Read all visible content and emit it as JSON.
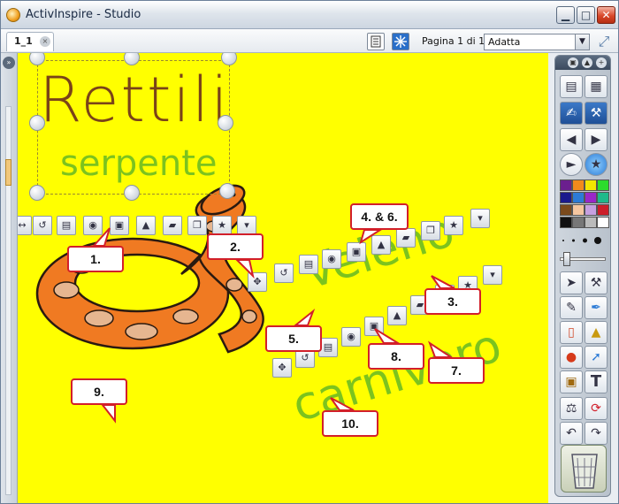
{
  "window": {
    "title": "ActivInspire - Studio"
  },
  "window_controls": {
    "minimize": "▁",
    "maximize": "□",
    "close": "✕"
  },
  "tabs": [
    {
      "label": "1_1",
      "close": "×"
    }
  ],
  "toolbar": {
    "page_indicator": "Pagina 1 di 1",
    "zoom_value": "Adatta",
    "zoom_arrow": "▼",
    "fullscreen_icon": "⤢"
  },
  "leftbar": {
    "toggle": "»"
  },
  "canvas": {
    "background": "#ffff00",
    "ink": {
      "title": "Rettili",
      "subtitle": "serpente",
      "word1": "Veleno",
      "word2": "carnivoro"
    },
    "callouts": [
      "1.",
      "2.",
      "3.",
      "4. & 6.",
      "5.",
      "7.",
      "8.",
      "9.",
      "10."
    ]
  },
  "colors": {
    "callout_border": "#d21f2a",
    "title_ink": "#7a4318",
    "green_ink": "#7cc31e",
    "snake_orange": "#f07a22",
    "snake_tan": "#e6b690"
  },
  "toolbox": {
    "head": {
      "pin": "▣",
      "collapse": "▲",
      "add": "+"
    },
    "palette": [
      "#6b1f8e",
      "#f28a1c",
      "#f2e600",
      "#2ddc2d",
      "#1b1a8c",
      "#2c7bd6",
      "#9a27c8",
      "#1fb98a",
      "#7a4a1c",
      "#f5c6a0",
      "#c6a0e0",
      "#cc1f2a",
      "#111111",
      "#777777",
      "#bbbbbb",
      "#ffffff"
    ],
    "icons": [
      "page-browser-icon",
      "object-browser-icon",
      "handwriting-icon",
      "settings-icon",
      "page-prev-icon",
      "page-next-icon",
      "play-icon",
      "globe-icon",
      "select-pointer-icon",
      "tools-icon",
      "pen-icon",
      "highlighter-icon",
      "eraser-icon",
      "fill-bucket-icon",
      "shape-icon",
      "connector-icon",
      "clapper-icon",
      "text-icon",
      "clear-icon",
      "reset-icon",
      "undo-icon",
      "redo-icon"
    ]
  }
}
